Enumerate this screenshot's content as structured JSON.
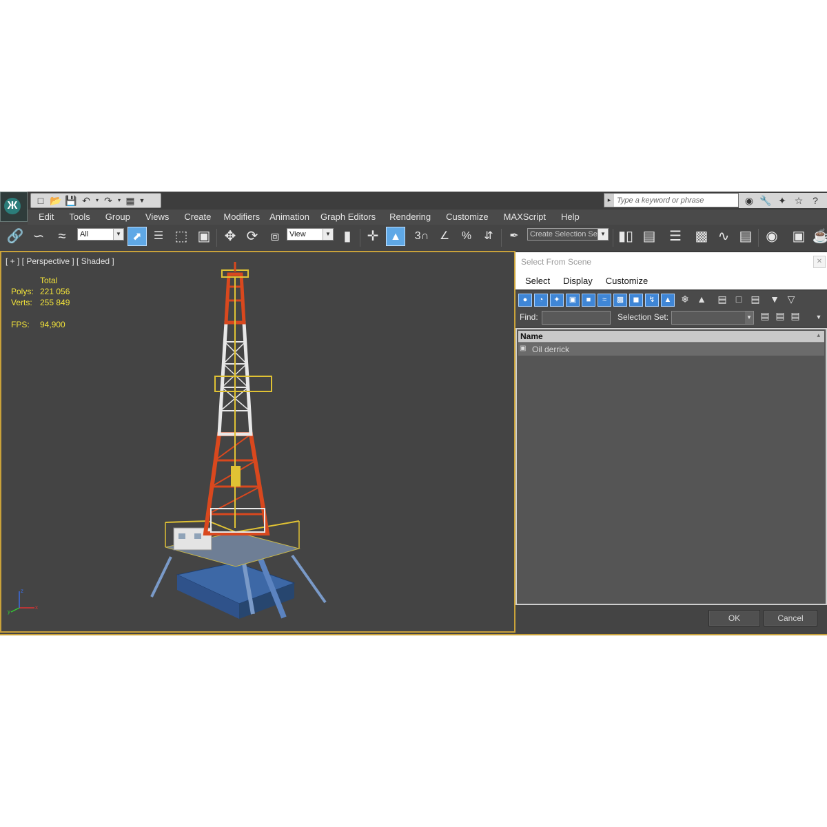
{
  "quick_access": {
    "icons": [
      "new-file-icon",
      "open-file-icon",
      "save-icon",
      "undo-icon",
      "redo-icon",
      "project-folder-icon"
    ]
  },
  "search": {
    "placeholder": "Type a keyword or phrase"
  },
  "menu": [
    "Edit",
    "Tools",
    "Group",
    "Views",
    "Create",
    "Modifiers",
    "Animation",
    "Graph Editors",
    "Rendering",
    "Customize",
    "MAXScript",
    "Help"
  ],
  "toolbar": {
    "filter_value": "All",
    "ref_coord_value": "View",
    "selection_set_value": "Create Selection Se"
  },
  "viewport": {
    "label": "[ + ] [ Perspective ] [ Shaded ]",
    "stats": {
      "total_label": "Total",
      "polys_label": "Polys:",
      "polys_value": "221 056",
      "verts_label": "Verts:",
      "verts_value": "255 849",
      "fps_label": "FPS:",
      "fps_value": "94,900"
    },
    "axis": {
      "x": "x",
      "y": "y",
      "z": "z"
    }
  },
  "dialog": {
    "title": "Select From Scene",
    "menu": [
      "Select",
      "Display",
      "Customize"
    ],
    "find_label": "Find:",
    "find_value": "",
    "selection_set_label": "Selection Set:",
    "list_header": "Name",
    "items": [
      "Oil derrick"
    ],
    "ok_label": "OK",
    "cancel_label": "Cancel"
  },
  "colors": {
    "viewport_border": "#c9a23a",
    "stats_text": "#f2e33a",
    "active_tool": "#5fa8e6",
    "derrick_red": "#d9481e",
    "derrick_white": "#e8e8e8",
    "derrick_blue": "#3d68a6",
    "rail_yellow": "#e0c234"
  }
}
